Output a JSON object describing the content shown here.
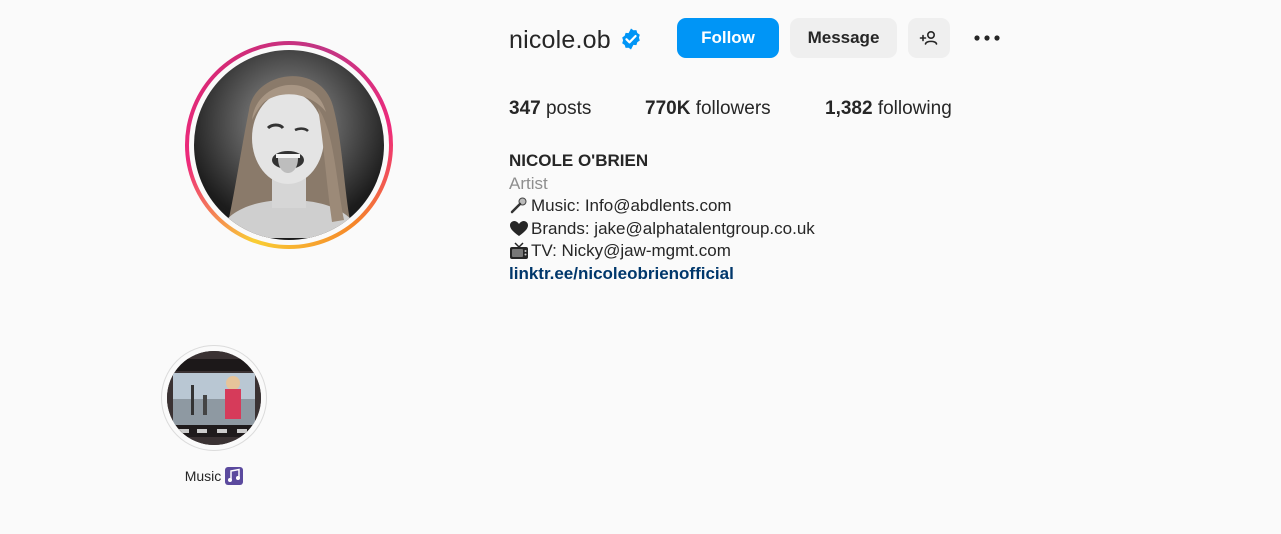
{
  "profile": {
    "username": "nicole.ob",
    "verified": true
  },
  "actions": {
    "follow_label": "Follow",
    "message_label": "Message"
  },
  "stats": {
    "posts_count": "347",
    "posts_label": "posts",
    "followers_count": "770K",
    "followers_label": "followers",
    "following_count": "1,382",
    "following_label": "following"
  },
  "bio": {
    "full_name": "NICOLE O'BRIEN",
    "category": "Artist",
    "lines": [
      {
        "icon": "microphone-icon",
        "text": "Music: Info@abdlents.com"
      },
      {
        "icon": "black-heart-icon",
        "text": "Brands: jake@alphatalentgroup.co.uk"
      },
      {
        "icon": "television-icon",
        "text": " TV: Nicky@jaw-mgmt.com"
      }
    ],
    "link": "linktr.ee/nicoleobrienofficial"
  },
  "highlights": [
    {
      "label": "Music",
      "icon": "musical-notes-icon"
    }
  ],
  "colors": {
    "follow_button": "#0095f6",
    "secondary_button": "#efefef",
    "link": "#00376b",
    "verified_badge": "#0095f6",
    "muted_text": "#8e8e8e"
  }
}
